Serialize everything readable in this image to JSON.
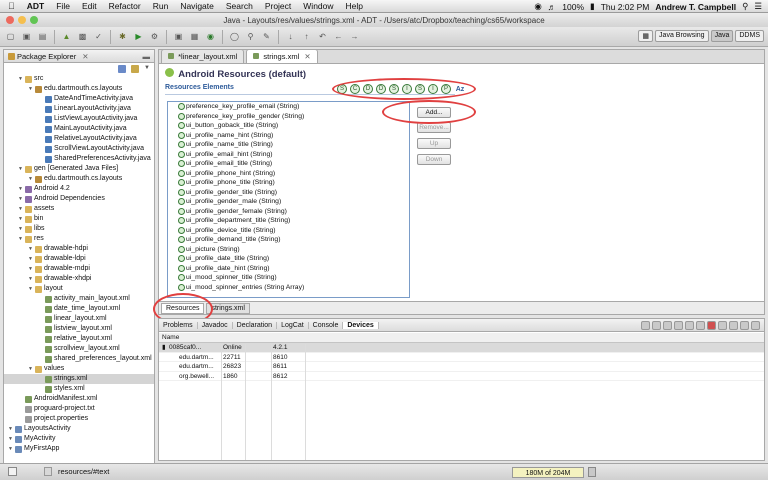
{
  "menubar": {
    "apple": "",
    "app_name": "ADT",
    "items": [
      "File",
      "Edit",
      "Refactor",
      "Run",
      "Navigate",
      "Search",
      "Project",
      "Window",
      "Help"
    ],
    "battery": "100%",
    "clock": "Thu 2:02 PM",
    "user": "Andrew T. Campbell"
  },
  "window": {
    "title": "Java - Layouts/res/values/strings.xml - ADT - /Users/atc/Dropbox/teaching/cs65/workspace"
  },
  "perspectives": [
    "Java Browsing",
    "Java",
    "DDMS"
  ],
  "package_explorer": {
    "title": "Package Explorer",
    "tree": [
      {
        "label": "src",
        "indent": 1,
        "icon": "folder"
      },
      {
        "label": "edu.dartmouth.cs.layouts",
        "indent": 2,
        "icon": "package"
      },
      {
        "label": "DateAndTimeActivity.java",
        "indent": 3,
        "icon": "java"
      },
      {
        "label": "LinearLayoutActivity.java",
        "indent": 3,
        "icon": "java"
      },
      {
        "label": "ListViewLayoutActivity.java",
        "indent": 3,
        "icon": "java"
      },
      {
        "label": "MainLayoutActivity.java",
        "indent": 3,
        "icon": "java"
      },
      {
        "label": "RelativeLayoutActivity.java",
        "indent": 3,
        "icon": "java"
      },
      {
        "label": "ScrollViewLayoutActivity.java",
        "indent": 3,
        "icon": "java"
      },
      {
        "label": "SharedPreferencesActivity.java",
        "indent": 3,
        "icon": "java"
      },
      {
        "label": "gen [Generated Java Files]",
        "indent": 1,
        "icon": "folder"
      },
      {
        "label": "edu.dartmouth.cs.layouts",
        "indent": 2,
        "icon": "package"
      },
      {
        "label": "Android 4.2",
        "indent": 1,
        "icon": "lib"
      },
      {
        "label": "Android Dependencies",
        "indent": 1,
        "icon": "lib"
      },
      {
        "label": "assets",
        "indent": 1,
        "icon": "folder"
      },
      {
        "label": "bin",
        "indent": 1,
        "icon": "folder"
      },
      {
        "label": "libs",
        "indent": 1,
        "icon": "folder"
      },
      {
        "label": "res",
        "indent": 1,
        "icon": "folder"
      },
      {
        "label": "drawable-hdpi",
        "indent": 2,
        "icon": "folder"
      },
      {
        "label": "drawable-ldpi",
        "indent": 2,
        "icon": "folder"
      },
      {
        "label": "drawable-mdpi",
        "indent": 2,
        "icon": "folder"
      },
      {
        "label": "drawable-xhdpi",
        "indent": 2,
        "icon": "folder"
      },
      {
        "label": "layout",
        "indent": 2,
        "icon": "folder"
      },
      {
        "label": "activity_main_layout.xml",
        "indent": 3,
        "icon": "xml"
      },
      {
        "label": "date_time_layout.xml",
        "indent": 3,
        "icon": "xml"
      },
      {
        "label": "linear_layout.xml",
        "indent": 3,
        "icon": "xml"
      },
      {
        "label": "listview_layout.xml",
        "indent": 3,
        "icon": "xml"
      },
      {
        "label": "relative_layout.xml",
        "indent": 3,
        "icon": "xml"
      },
      {
        "label": "scrollview_layout.xml",
        "indent": 3,
        "icon": "xml"
      },
      {
        "label": "shared_preferences_layout.xml",
        "indent": 3,
        "icon": "xml"
      },
      {
        "label": "values",
        "indent": 2,
        "icon": "folder"
      },
      {
        "label": "strings.xml",
        "indent": 3,
        "icon": "xml",
        "selected": true
      },
      {
        "label": "styles.xml",
        "indent": 3,
        "icon": "xml"
      },
      {
        "label": "AndroidManifest.xml",
        "indent": 1,
        "icon": "xml"
      },
      {
        "label": "proguard-project.txt",
        "indent": 1,
        "icon": "txt"
      },
      {
        "label": "project.properties",
        "indent": 1,
        "icon": "txt"
      },
      {
        "label": "LayoutsActivity",
        "indent": 0,
        "icon": "project"
      },
      {
        "label": "MyActivity",
        "indent": 0,
        "icon": "project"
      },
      {
        "label": "MyFirstApp",
        "indent": 0,
        "icon": "project"
      }
    ]
  },
  "editor": {
    "tabs": [
      "*linear_layout.xml",
      "strings.xml"
    ],
    "form_title": "Android Resources (default)",
    "section_title": "Resources Elements",
    "type_icons": [
      "S",
      "C",
      "D",
      "D",
      "S",
      "I",
      "S",
      "I",
      "P"
    ],
    "sort_label": "Az",
    "resources": [
      "preference_key_profile_email (String)",
      "preference_key_profile_gender (String)",
      "ui_button_goback_title (String)",
      "ui_profile_name_hint (String)",
      "ui_profile_name_title (String)",
      "ui_profile_email_hint (String)",
      "ui_profile_email_title (String)",
      "ui_profile_phone_hint (String)",
      "ui_profile_phone_title (String)",
      "ui_profile_gender_title (String)",
      "ui_profile_gender_male (String)",
      "ui_profile_gender_female (String)",
      "ui_profile_department_title (String)",
      "ui_profile_device_title (String)",
      "ui_profile_demand_title (String)",
      "ui_picture (String)",
      "ui_profile_date_title (String)",
      "ui_profile_date_hint (String)",
      "ui_mood_spinner_title (String)",
      "ui_mood_spinner_entries (String Array)"
    ],
    "buttons": {
      "add": "Add...",
      "remove": "Remove...",
      "up": "Up",
      "down": "Down"
    },
    "bottom_tabs": [
      "Resources",
      "strings.xml"
    ]
  },
  "views": {
    "tabs": [
      "Problems",
      "Javadoc",
      "Declaration",
      "LogCat",
      "Console",
      "Devices"
    ],
    "column_header": "Name",
    "rows": [
      {
        "name": "0085caf0...",
        "col2": "Online",
        "col3": "",
        "col4": "4.2.1"
      },
      {
        "name": "edu.dartm...",
        "col2": "22711",
        "col3": "",
        "col4": "8610"
      },
      {
        "name": "edu.dartm...",
        "col2": "26823",
        "col3": "",
        "col4": "8611"
      },
      {
        "name": "org.bewell...",
        "col2": "1860",
        "col3": "",
        "col4": "8612"
      }
    ]
  },
  "status": {
    "path": "resources/#text",
    "heap": "180M of 204M"
  }
}
